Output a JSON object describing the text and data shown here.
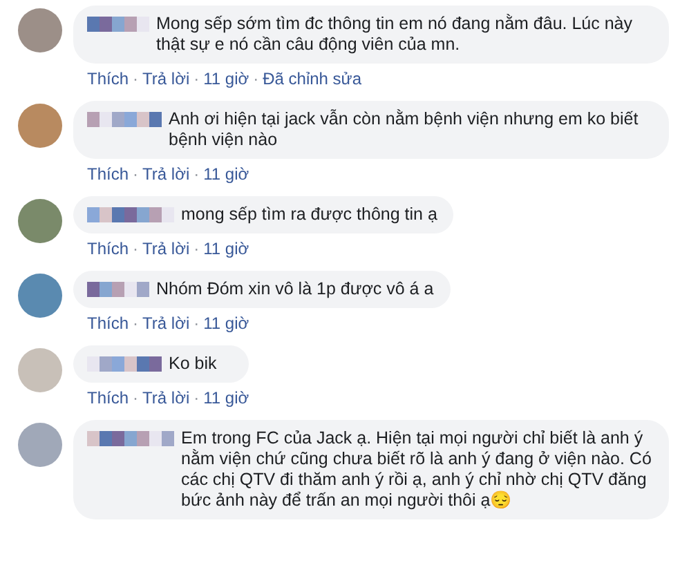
{
  "separator": "·",
  "comments": [
    {
      "text": "Mong sếp sớm tìm đc thông tin em nó đang nằm đâu. Lúc này thật sự e nó cần câu động viên của mn.",
      "actions": [
        "Thích",
        "Trả lời",
        "11 giờ",
        "Đã chỉnh sửa"
      ]
    },
    {
      "text": "Anh ơi hiện tại jack vẫn còn nằm bệnh viện nhưng em ko biết bệnh viện nào",
      "actions": [
        "Thích",
        "Trả lời",
        "11 giờ"
      ]
    },
    {
      "text": "mong sếp tìm ra được thông tin ạ",
      "actions": [
        "Thích",
        "Trả lời",
        "11 giờ"
      ]
    },
    {
      "text": "Nhóm Đóm xin vô là 1p được vô á a",
      "actions": [
        "Thích",
        "Trả lời",
        "11 giờ"
      ]
    },
    {
      "text": "Ko bik",
      "actions": [
        "Thích",
        "Trả lời",
        "11 giờ"
      ]
    },
    {
      "text": "Em trong FC của Jack ạ. Hiện tại mọi người chỉ biết là anh ý nằm viện chứ cũng chưa biết rõ là anh ý đang ở viện nào. Có các chị QTV đi thăm anh ý rồi ạ, anh ý chỉ nhờ chị QTV đăng bức ảnh này để trấn an mọi người thôi ạ😔"
    }
  ]
}
